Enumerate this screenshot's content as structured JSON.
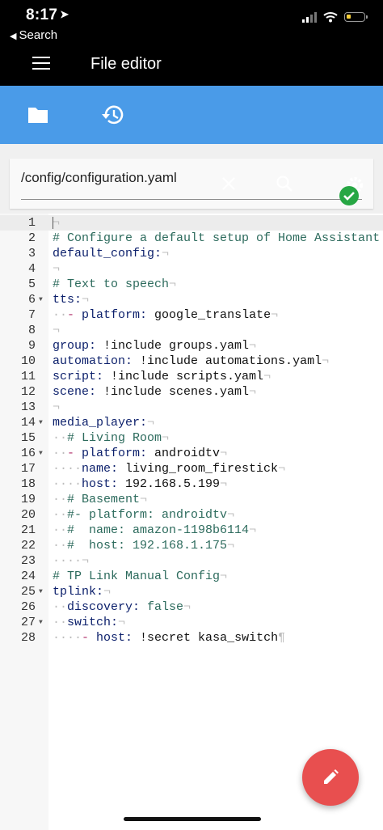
{
  "status_bar": {
    "time": "8:17",
    "back_label": "Search"
  },
  "header": {
    "title": "File editor"
  },
  "file": {
    "path": "/config/configuration.yaml"
  },
  "icons": {
    "menu": "menu-icon",
    "folder": "folder-icon",
    "history": "history-icon",
    "close": "close-icon",
    "search": "search-icon",
    "settings": "gear-icon",
    "status": "check-circle-icon",
    "edit": "pencil-icon"
  },
  "colors": {
    "toolbar": "#4a9be8",
    "fab": "#e84f4f",
    "status_ok": "#27a744"
  },
  "editor": {
    "lines": [
      {
        "n": "1",
        "text": "",
        "tail": "¬",
        "active": true
      },
      {
        "n": "2",
        "text": "# Configure a default setup of Home Assistant",
        "type": "comment"
      },
      {
        "n": "3",
        "text": "default_config:",
        "tail": "¬"
      },
      {
        "n": "4",
        "text": "",
        "tail": "¬"
      },
      {
        "n": "5",
        "text": "# Text to speech",
        "type": "comment",
        "tail": "¬"
      },
      {
        "n": "6",
        "text": "tts:",
        "tail": "¬",
        "fold": true
      },
      {
        "n": "7",
        "text": "  - platform: google_translate",
        "lead": "··",
        "tail": "¬"
      },
      {
        "n": "8",
        "text": "",
        "tail": "¬"
      },
      {
        "n": "9",
        "text": "group: !include groups.yaml",
        "tail": "¬"
      },
      {
        "n": "10",
        "text": "automation: !include automations.yaml",
        "tail": "¬"
      },
      {
        "n": "11",
        "text": "script: !include scripts.yaml",
        "tail": "¬"
      },
      {
        "n": "12",
        "text": "scene: !include scenes.yaml",
        "tail": "¬"
      },
      {
        "n": "13",
        "text": "",
        "tail": "¬"
      },
      {
        "n": "14",
        "text": "media_player:",
        "tail": "¬",
        "fold": true
      },
      {
        "n": "15",
        "text": "  # Living Room",
        "type": "comment",
        "lead": "··",
        "tail": "¬"
      },
      {
        "n": "16",
        "text": "  - platform: androidtv",
        "lead": "··",
        "tail": "¬",
        "fold": true
      },
      {
        "n": "17",
        "text": "    name: living_room_firestick",
        "lead": "····",
        "tail": "¬"
      },
      {
        "n": "18",
        "text": "    host: 192.168.5.199",
        "lead": "····",
        "tail": "¬"
      },
      {
        "n": "19",
        "text": "  # Basement",
        "type": "comment",
        "lead": "··",
        "tail": "¬"
      },
      {
        "n": "20",
        "text": "  #- platform: androidtv",
        "type": "comment",
        "lead": "··",
        "tail": "¬"
      },
      {
        "n": "21",
        "text": "  #  name: amazon-1198b6114",
        "type": "comment",
        "lead": "··",
        "tail": "¬"
      },
      {
        "n": "22",
        "text": "  #  host: 192.168.1.175",
        "type": "comment",
        "lead": "··",
        "tail": "¬"
      },
      {
        "n": "23",
        "text": "    ",
        "lead": "····",
        "tail": "¬"
      },
      {
        "n": "24",
        "text": "# TP Link Manual Config",
        "type": "comment",
        "tail": "¬"
      },
      {
        "n": "25",
        "text": "tplink:",
        "tail": "¬",
        "fold": true
      },
      {
        "n": "26",
        "text": "  discovery: false",
        "lead": "··",
        "tail": "¬"
      },
      {
        "n": "27",
        "text": "  switch:",
        "lead": "··",
        "tail": "¬",
        "fold": true
      },
      {
        "n": "28",
        "text": "    - host: !secret kasa_switch",
        "lead": "····",
        "tail": "¶"
      }
    ]
  }
}
